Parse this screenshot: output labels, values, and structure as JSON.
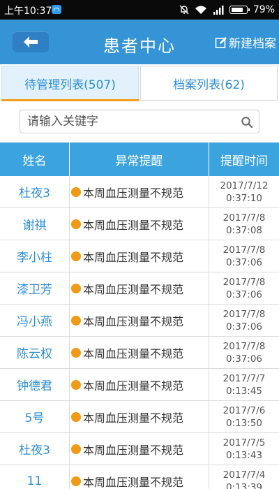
{
  "status_bar": {
    "time": "上午10:37",
    "battery": "79%",
    "icons": [
      "app-notification-icon",
      "bell-muted-icon",
      "wifi-icon",
      "signal-icon",
      "battery-icon"
    ]
  },
  "header": {
    "title": "患者中心",
    "new_record_label": "新建档案",
    "back_icon": "back-arrow-icon",
    "new_icon": "edit-icon"
  },
  "tabs": [
    {
      "label": "待管理列表(507)",
      "active": true
    },
    {
      "label": "档案列表(62)",
      "active": false
    }
  ],
  "search": {
    "placeholder": "请输入关键字",
    "value": ""
  },
  "table": {
    "columns": [
      "姓名",
      "异常提醒",
      "提醒时间"
    ],
    "rows": [
      {
        "name": "杜夜3",
        "alert": "本周血压测量不规范",
        "date": "2017/7/12",
        "time": "0:37:10"
      },
      {
        "name": "谢祺",
        "alert": "本周血压测量不规范",
        "date": "2017/7/8",
        "time": "0:37:08"
      },
      {
        "name": "李小柱",
        "alert": "本周血压测量不规范",
        "date": "2017/7/8",
        "time": "0:37:06"
      },
      {
        "name": "漆卫芳",
        "alert": "本周血压测量不规范",
        "date": "2017/7/8",
        "time": "0:37:06"
      },
      {
        "name": "冯小燕",
        "alert": "本周血压测量不规范",
        "date": "2017/7/8",
        "time": "0:37:06"
      },
      {
        "name": "陈云权",
        "alert": "本周血压测量不规范",
        "date": "2017/7/8",
        "time": "0:37:06"
      },
      {
        "name": "钟德君",
        "alert": "本周血压测量不规范",
        "date": "2017/7/7",
        "time": "0:13:45"
      },
      {
        "name": "5号",
        "alert": "本周血压测量不规范",
        "date": "2017/7/6",
        "time": "0:13:50"
      },
      {
        "name": "杜夜3",
        "alert": "本周血压测量不规范",
        "date": "2017/7/5",
        "time": "0:13:43"
      },
      {
        "name": "11",
        "alert": "本周血压测量不规范",
        "date": "2017/7/4",
        "time": "0:13:39"
      }
    ]
  },
  "colors": {
    "header_blue": "#3494d6",
    "table_header_blue": "#3ba3de",
    "link_blue": "#2b8ed8",
    "alert_dot_orange": "#f39a14",
    "tab_underline_orange": "#f29c1b"
  }
}
